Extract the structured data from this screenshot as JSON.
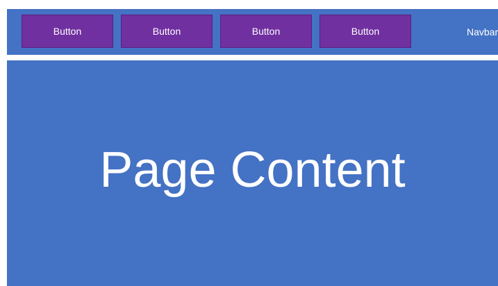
{
  "navbar": {
    "label": "Navbar",
    "buttons": [
      {
        "label": "Button"
      },
      {
        "label": "Button"
      },
      {
        "label": "Button"
      },
      {
        "label": "Button"
      }
    ]
  },
  "main": {
    "label": "Page Content"
  },
  "colors": {
    "panel": "#4472c4",
    "button": "#7030a0",
    "text": "#ffffff"
  }
}
